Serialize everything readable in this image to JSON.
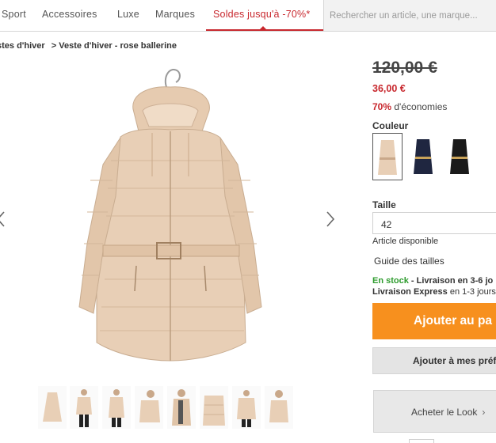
{
  "nav": {
    "items": [
      "Sport",
      "Accessoires",
      "Luxe",
      "Marques",
      "Soldes jusqu'à -70%*"
    ],
    "search_placeholder": "Rechercher un article, une marque..."
  },
  "breadcrumb": {
    "parent": "stes d'hiver",
    "current": "> Veste d'hiver - rose ballerine"
  },
  "product": {
    "price_old": "120,00 €",
    "price_new": "36,00 €",
    "savings_pct": "70%",
    "savings_text": "d'économies",
    "color_label": "Couleur",
    "colors": [
      {
        "name": "rose ballerine",
        "hex": "#e8cfb6",
        "selected": true
      },
      {
        "name": "navy",
        "hex": "#1f2640",
        "selected": false
      },
      {
        "name": "black",
        "hex": "#1a1a1a",
        "selected": false
      }
    ],
    "size_label": "Taille",
    "size_value": "42",
    "availability": "Article disponible",
    "size_guide": "Guide des tailles",
    "stock_status": "En stock",
    "delivery_line1": " - Livraison en 3-6 jo",
    "delivery_express": "Livraison Express",
    "delivery_line2": " en 1-3 jours",
    "add_to_cart": "Ajouter au pa",
    "add_to_wishlist": "Ajouter à mes préf",
    "buy_look": "Acheter le Look",
    "buy_look_chevron": "›"
  },
  "colors": {
    "accent_red": "#c8282e",
    "cart_orange": "#f7901e",
    "stock_green": "#2e9c2e",
    "jacket_beige": "#e8cfb6"
  },
  "icons": {
    "prev": "chevron-left-icon",
    "next": "chevron-right-icon"
  }
}
